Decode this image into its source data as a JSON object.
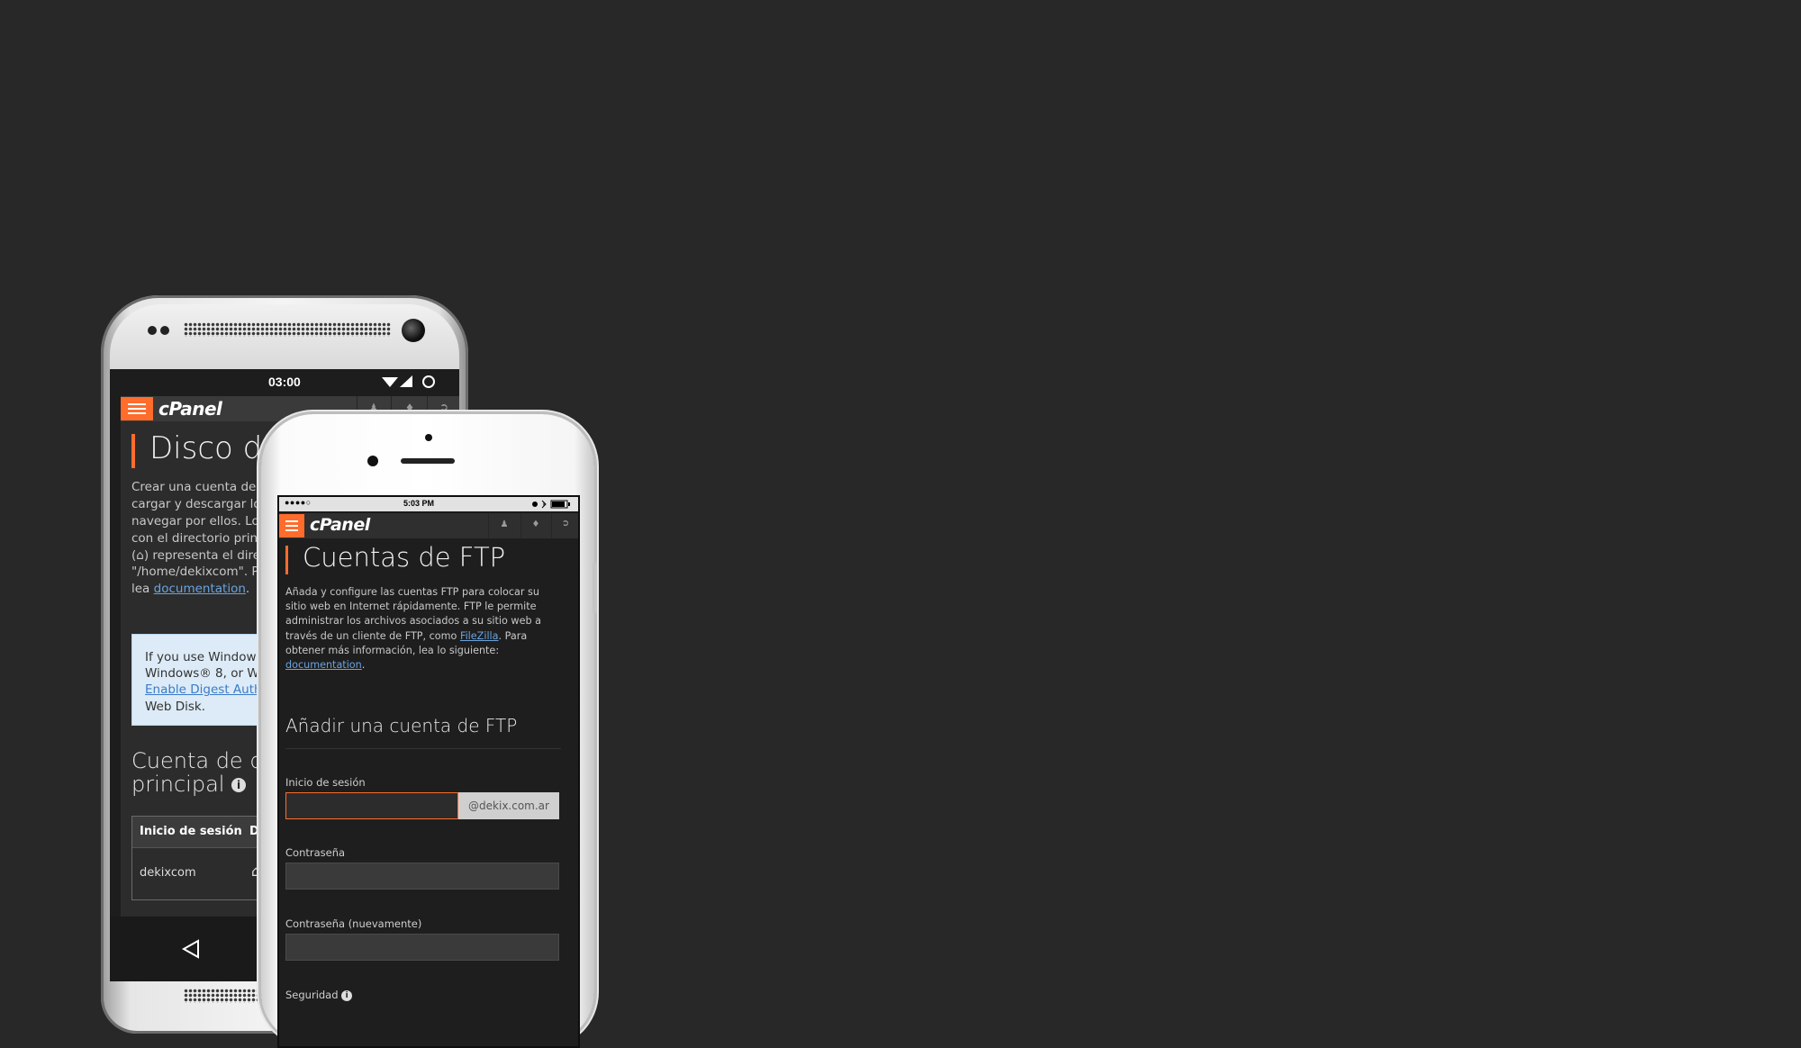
{
  "colors": {
    "background": "#282828",
    "accent": "#ff6c2c",
    "link": "#6aa3e0"
  },
  "android": {
    "status_time": "03:00",
    "logo": "cPanel",
    "page_title": "Disco de",
    "description_lines": [
      "Crear una cuenta de di",
      "cargar y descargar los a",
      "navegar por ellos. Los",
      "con el directorio princi",
      ") representa el direc",
      "\"/home/dekixcom\". Par",
      "lea"
    ],
    "description_link": "documentation",
    "notice_lines": [
      "If you use Windows V",
      "Windows® 8, or Win"
    ],
    "notice_link": "Enable Digest Authe",
    "notice_tail": "Web Disk.",
    "section_title_line1": "Cuenta de dis",
    "section_title_line2": "principal",
    "table": {
      "header_login": "Inicio de sesión",
      "header_dir": "D",
      "row_login": "dekixcom"
    }
  },
  "iphone": {
    "status_time": "5:03 PM",
    "logo": "cPanel",
    "page_title": "Cuentas de FTP",
    "description_lines": [
      "Añada y configure las cuentas FTP para colocar su",
      "sitio web en Internet rápidamente. FTP le permite",
      "administrar los archivos asociados a su sitio web a",
      "través de un cliente de FTP, como ",
      ". Para",
      "obtener más información, lea lo siguiente:"
    ],
    "link_filezilla": "FileZilla",
    "link_documentation": "documentation",
    "section_title": "Añadir una cuenta de FTP",
    "login_label": "Inicio de sesión",
    "login_value": "",
    "domain_suffix": "@dekix.com.ar",
    "password_label": "Contraseña",
    "password_value": "",
    "password_again_label": "Contraseña (nuevamente)",
    "password_again_value": "",
    "security_label": "Seguridad"
  }
}
